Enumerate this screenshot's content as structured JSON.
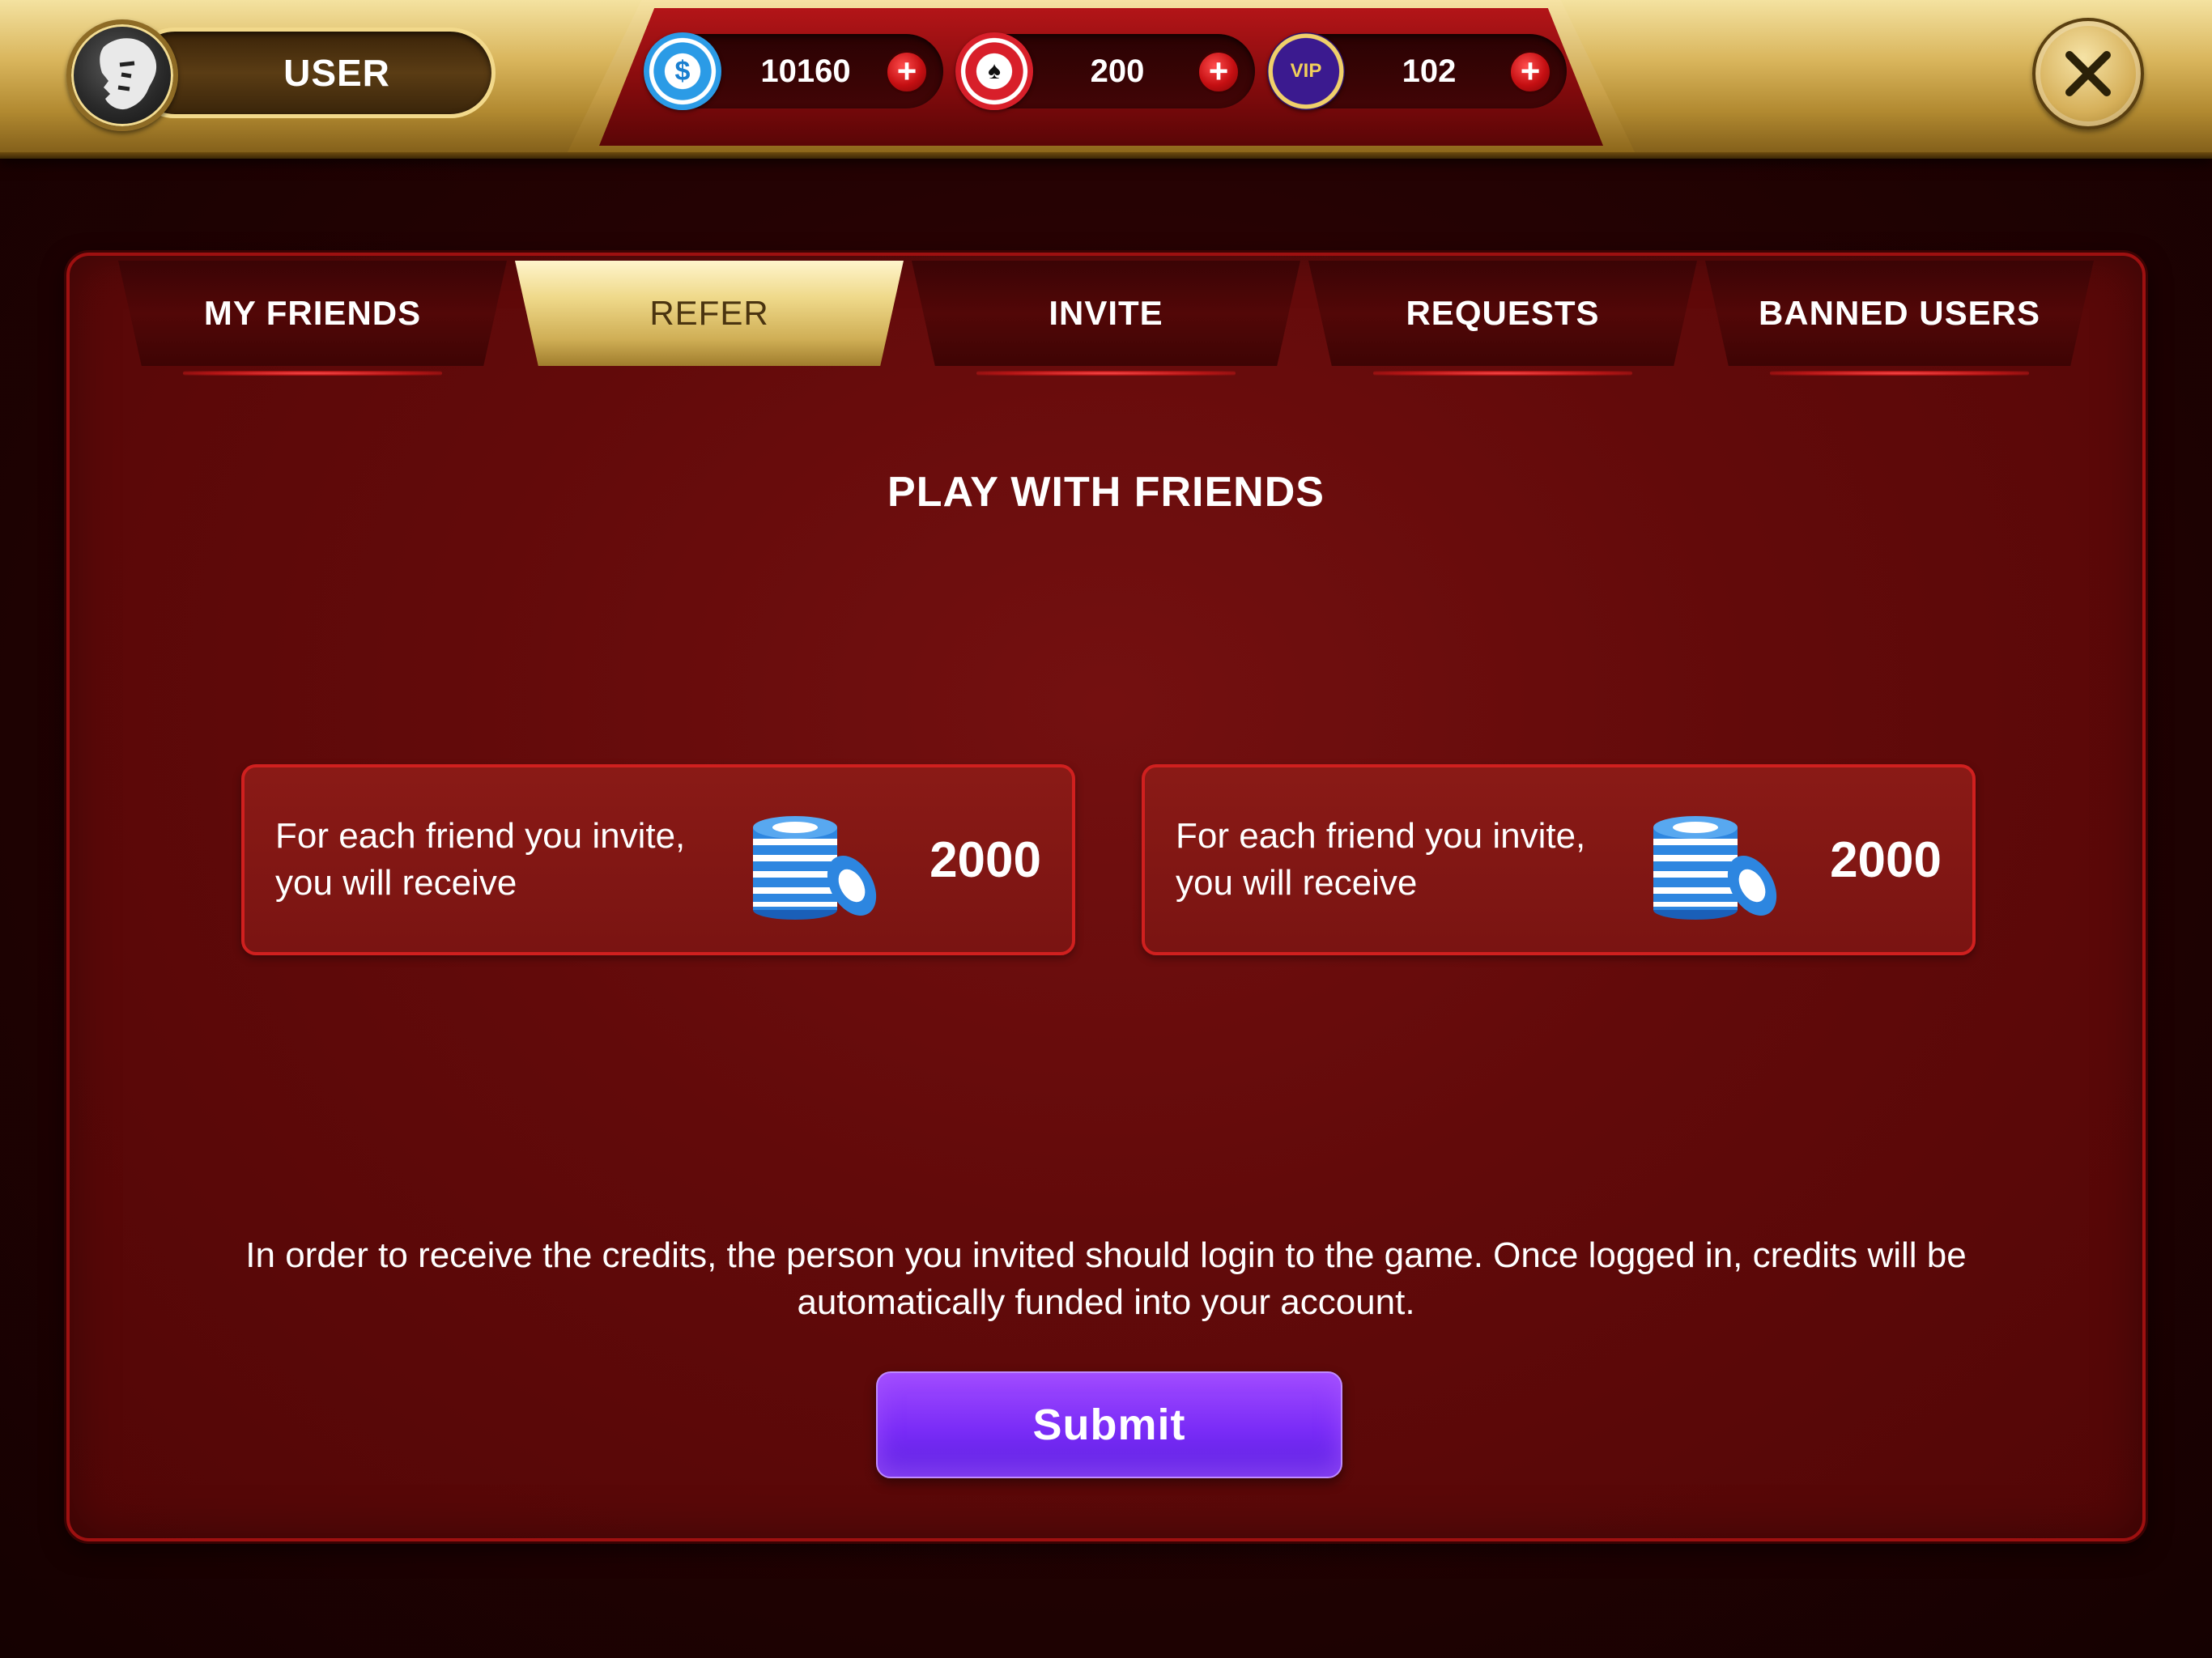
{
  "header": {
    "username": "USER",
    "currencies": [
      {
        "id": "cash",
        "icon": "dollar-chip-icon",
        "symbol": "$",
        "amount": "10160",
        "add": "+"
      },
      {
        "id": "chips",
        "icon": "spade-chip-icon",
        "symbol": "♠",
        "amount": "200",
        "add": "+"
      },
      {
        "id": "vip",
        "icon": "vip-crown-icon",
        "symbol": "VIP",
        "amount": "102",
        "add": "+"
      }
    ],
    "close_icon": "close-icon"
  },
  "tabs": [
    {
      "label": "MY FRIENDS",
      "active": false
    },
    {
      "label": "REFER",
      "active": true
    },
    {
      "label": "INVITE",
      "active": false
    },
    {
      "label": "REQUESTS",
      "active": false
    },
    {
      "label": "BANNED USERS",
      "active": false
    }
  ],
  "main": {
    "title": "PLAY WITH FRIENDS",
    "rewards": [
      {
        "text": "For each friend you invite, you will receive",
        "value": "2000",
        "icon": "chip-stack-icon"
      },
      {
        "text": "For each friend you invite, you will receive",
        "value": "2000",
        "icon": "chip-stack-icon"
      }
    ],
    "info": "In order to receive the credits, the person you invited should login to the game. Once logged in, credits will be automatically funded into your account.",
    "submit_label": "Submit"
  },
  "colors": {
    "gold": "#d9b55c",
    "panel_red": "#620a0a",
    "accent_red": "#d0201f",
    "submit_purple": "#7a2cf7"
  }
}
